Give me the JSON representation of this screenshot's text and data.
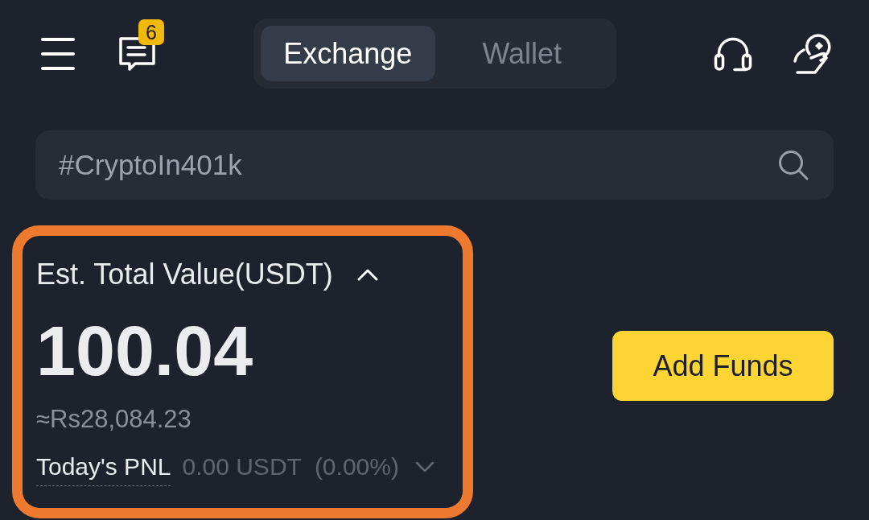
{
  "header": {
    "notification_count": "6",
    "tabs": [
      {
        "label": "Exchange",
        "selected": true
      },
      {
        "label": "Wallet",
        "selected": false
      }
    ]
  },
  "search": {
    "placeholder": "#CryptoIn401k"
  },
  "balance": {
    "title": "Est. Total Value(USDT)",
    "expanded": true,
    "amount": "100.04",
    "fiat": "≈Rs28,084.23",
    "pnl_label": "Today's PNL",
    "pnl_value": "0.00 USDT",
    "pnl_percent": "(0.00%)"
  },
  "add_funds_button": "Add Funds"
}
